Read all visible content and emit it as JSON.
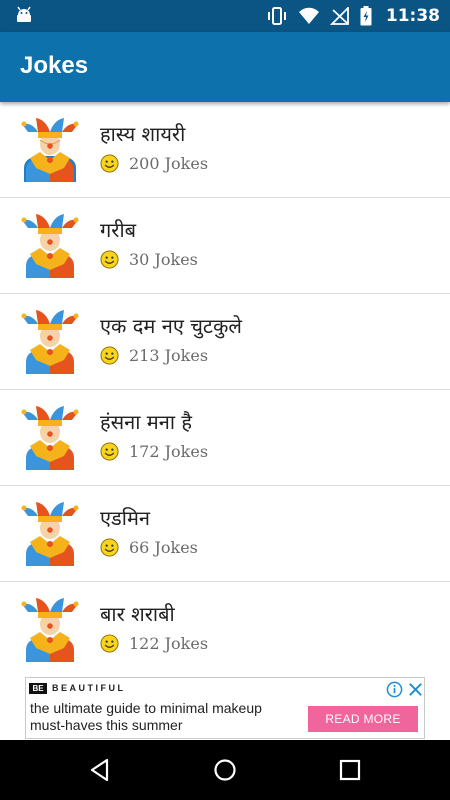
{
  "status_bar": {
    "time": "11:38",
    "icons": [
      "android-debug-icon",
      "vibrate-icon",
      "wifi-icon",
      "no-signal-icon",
      "battery-charging-icon"
    ]
  },
  "app_bar": {
    "title": "Jokes"
  },
  "categories": [
    {
      "name": "हास्य शायरी",
      "count": "200 Jokes"
    },
    {
      "name": "गरीब",
      "count": "30 Jokes"
    },
    {
      "name": "एक दम नए चुटकुले",
      "count": "213 Jokes"
    },
    {
      "name": "हंसना मना है",
      "count": "172 Jokes"
    },
    {
      "name": "एडमिन",
      "count": "66 Jokes"
    },
    {
      "name": "बार शराबी",
      "count": "122 Jokes"
    }
  ],
  "ad": {
    "brand_box": "BE",
    "brand": "BEAUTIFUL",
    "line1": "the ultimate guide to minimal makeup",
    "line2": "must-haves this summer",
    "cta": "READ MORE"
  },
  "nav_bar": {
    "buttons": [
      "back-icon",
      "home-icon",
      "recents-icon"
    ]
  },
  "colors": {
    "status_bar": "#0b5584",
    "app_bar": "#0d72ab",
    "divider": "#dcdcdc",
    "cta": "#f0659b",
    "count_text": "#6b6b6b"
  }
}
